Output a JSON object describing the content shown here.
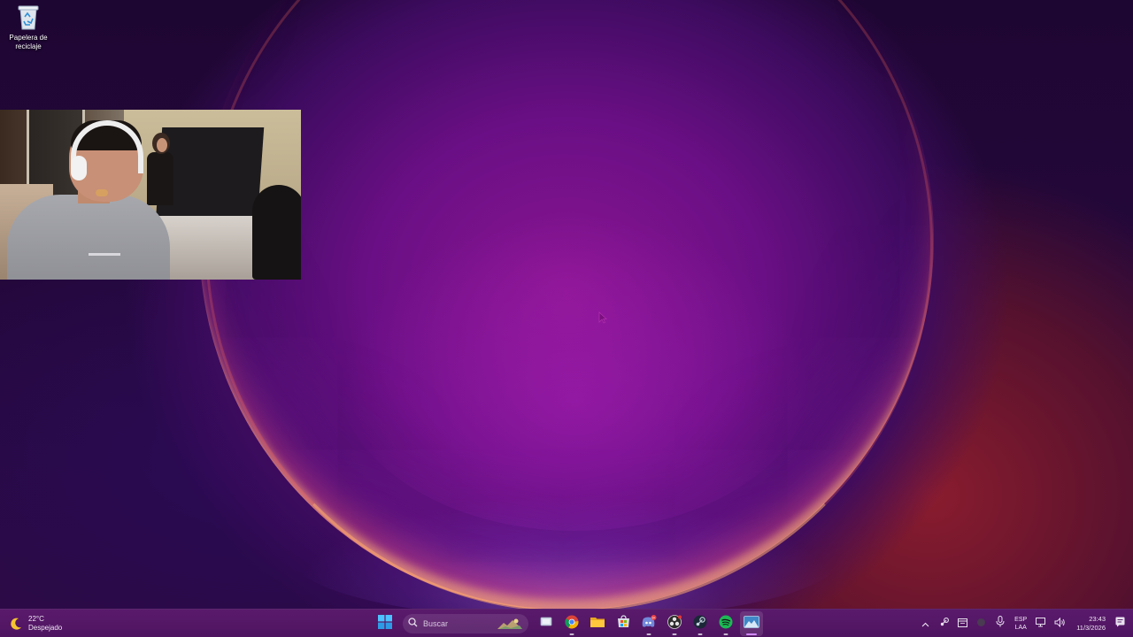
{
  "desktop": {
    "icons": [
      {
        "label": "Papelera de reciclaje",
        "icon": "recycle-bin-icon"
      }
    ]
  },
  "overlay": {
    "type": "webcam-feed"
  },
  "taskbar": {
    "weather": {
      "temperature": "22°C",
      "condition": "Despejado",
      "icon": "moon-icon"
    },
    "search": {
      "placeholder": "Buscar"
    },
    "apps": [
      {
        "name": "start",
        "icon": "windows-start-icon"
      },
      {
        "name": "task-view",
        "icon": "task-view-icon"
      },
      {
        "name": "chrome",
        "icon": "chrome-icon"
      },
      {
        "name": "file-explorer",
        "icon": "folder-icon"
      },
      {
        "name": "microsoft-store",
        "icon": "store-icon"
      },
      {
        "name": "discord",
        "icon": "discord-icon",
        "badge": "9+"
      },
      {
        "name": "obs",
        "icon": "obs-icon"
      },
      {
        "name": "steam",
        "icon": "steam-icon"
      },
      {
        "name": "spotify",
        "icon": "spotify-icon"
      },
      {
        "name": "active-app",
        "icon": "landscape-app-icon",
        "active": true
      }
    ],
    "tray": {
      "language_line1": "ESP",
      "language_line2": "LAA",
      "time": "23:43",
      "date": "11/3/2026"
    }
  },
  "colors": {
    "taskbar": "#4e1460",
    "accent": "#d28bff",
    "wallpaper_primary": "#8a1592",
    "wallpaper_glow": "#ff9a6a"
  }
}
